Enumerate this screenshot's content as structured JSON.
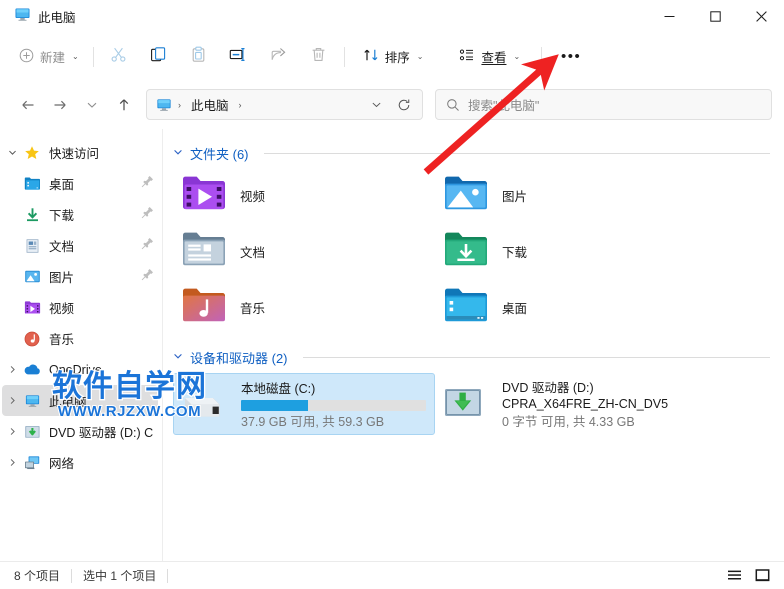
{
  "window": {
    "tab_title": "此电脑",
    "tab_icon": "this-pc-icon",
    "minimize_label": "—",
    "maximize_label": "□",
    "close_label": "✕"
  },
  "commandbar": {
    "new_label": "新建",
    "new_icon": "plus-circle-icon",
    "cut_icon": "scissors-icon",
    "copy_icon": "copy-icon",
    "paste_icon": "clipboard-icon",
    "rename_icon": "rename-icon",
    "share_icon": "share-icon",
    "delete_icon": "trash-icon",
    "sort_label": "排序",
    "sort_icon": "sort-arrows-icon",
    "view_label": "查看",
    "view_icon": "view-list-icon",
    "more_label": "•••",
    "chevron": "⌄"
  },
  "navbar": {
    "back_icon": "arrow-left-icon",
    "forward_icon": "arrow-right-icon",
    "recent_icon": "chevron-down-icon",
    "up_icon": "arrow-up-icon",
    "breadcrumb_icon": "this-pc-icon",
    "breadcrumb": [
      "此电脑"
    ],
    "breadcrumb_sep": "›",
    "address_dropdown_icon": "chevron-down-icon",
    "refresh_icon": "refresh-icon",
    "search_icon": "search-icon",
    "search_placeholder": "搜索\"此电脑\"",
    "search_value": ""
  },
  "sidebar": {
    "items": [
      {
        "label": "快速访问",
        "icon": "star-icon",
        "level": 0,
        "twisty": "expanded",
        "pinned": false,
        "selected": false
      },
      {
        "label": "桌面",
        "icon": "desktop-folder-icon",
        "level": 1,
        "twisty": "none",
        "pinned": true,
        "selected": false
      },
      {
        "label": "下载",
        "icon": "downloads-folder-icon",
        "level": 1,
        "twisty": "none",
        "pinned": true,
        "selected": false
      },
      {
        "label": "文档",
        "icon": "documents-folder-icon",
        "level": 1,
        "twisty": "none",
        "pinned": true,
        "selected": false
      },
      {
        "label": "图片",
        "icon": "pictures-folder-icon",
        "level": 1,
        "twisty": "none",
        "pinned": true,
        "selected": false
      },
      {
        "label": "视频",
        "icon": "videos-folder-icon",
        "level": 1,
        "twisty": "none",
        "pinned": false,
        "selected": false
      },
      {
        "label": "音乐",
        "icon": "music-folder-icon",
        "level": 1,
        "twisty": "none",
        "pinned": false,
        "selected": false
      },
      {
        "label": "OneDrive",
        "icon": "onedrive-cloud-icon",
        "level": 0,
        "twisty": "collapsed",
        "pinned": false,
        "selected": false
      },
      {
        "label": "此电脑",
        "icon": "this-pc-icon",
        "level": 0,
        "twisty": "collapsed",
        "pinned": false,
        "selected": true
      },
      {
        "label": "DVD 驱动器 (D:) CP",
        "icon": "dvd-drive-icon",
        "level": 0,
        "twisty": "collapsed",
        "pinned": false,
        "selected": false
      },
      {
        "label": "网络",
        "icon": "network-icon",
        "level": 0,
        "twisty": "collapsed",
        "pinned": false,
        "selected": false
      }
    ]
  },
  "main": {
    "folders_group": {
      "title": "文件夹 (6)",
      "twisty": "⌄",
      "items": [
        {
          "label": "视频",
          "icon": "videos-folder-icon"
        },
        {
          "label": "图片",
          "icon": "pictures-folder-icon"
        },
        {
          "label": "文档",
          "icon": "documents-folder-icon"
        },
        {
          "label": "下载",
          "icon": "downloads-folder-icon"
        },
        {
          "label": "音乐",
          "icon": "music-folder-icon"
        },
        {
          "label": "桌面",
          "icon": "desktop-folder-icon"
        }
      ]
    },
    "devices_group": {
      "title": "设备和驱动器 (2)",
      "twisty": "⌄",
      "items": [
        {
          "name": "本地磁盘 (C:)",
          "subtitle": "",
          "free_text": "37.9 GB 可用, 共 59.3 GB",
          "used_percent": 36,
          "bar_color": "#1e9fe0",
          "has_bar": true,
          "icon": "hard-drive-icon",
          "selected": true
        },
        {
          "name": "DVD 驱动器 (D:)",
          "subtitle": "CPRA_X64FRE_ZH-CN_DV5",
          "free_text": "0 字节 可用, 共 4.33 GB",
          "used_percent": 0,
          "bar_color": "#1e9fe0",
          "has_bar": false,
          "icon": "dvd-drive-icon",
          "selected": false
        }
      ]
    }
  },
  "statusbar": {
    "item_count": "8 个项目",
    "selection": "选中 1 个项目",
    "details_view_icon": "list-view-icon",
    "large_icons_view_icon": "large-icons-view-icon"
  },
  "watermark": {
    "main": "软件自学网",
    "sub": "WWW.RJZXW.COM",
    "color": "#1b74d8"
  },
  "annotation": {
    "arrow_color": "#ee2222",
    "arrow_from": "425,172",
    "arrow_to": "548,64",
    "points_at": "查看"
  }
}
